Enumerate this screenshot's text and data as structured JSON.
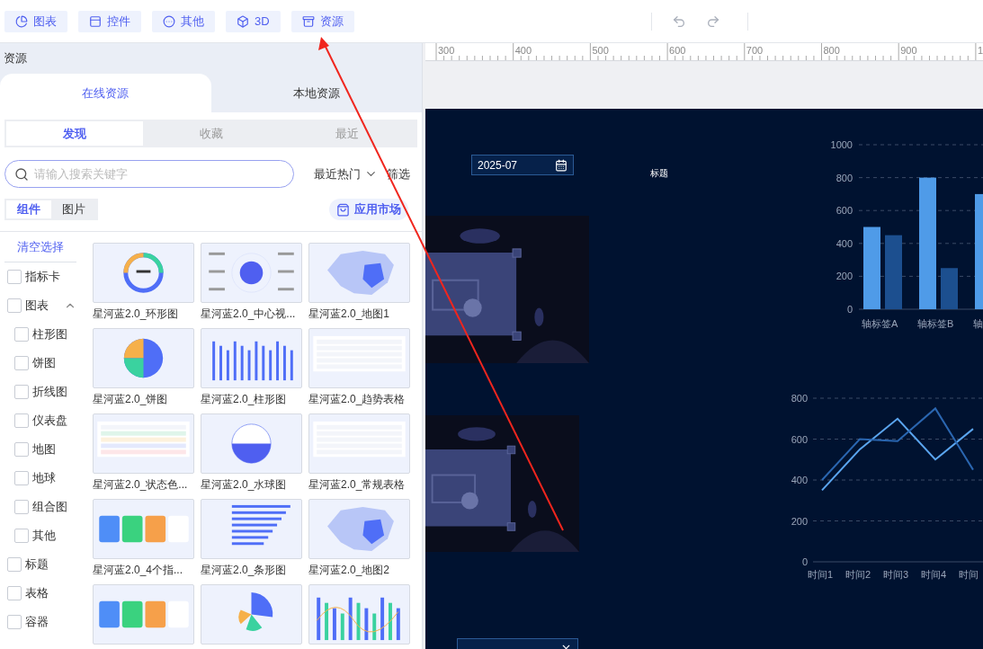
{
  "toolbar": {
    "buttons": [
      {
        "label": "图表",
        "kind": "chart"
      },
      {
        "label": "控件",
        "kind": "control"
      },
      {
        "label": "其他",
        "kind": "other"
      },
      {
        "label": "3D",
        "kind": "cube"
      },
      {
        "label": "资源",
        "kind": "resource"
      }
    ]
  },
  "panel": {
    "title": "资源",
    "source_tabs": [
      {
        "label": "在线资源",
        "selected": true
      },
      {
        "label": "本地资源",
        "selected": false
      }
    ],
    "view_tabs": [
      {
        "label": "发现",
        "selected": true
      },
      {
        "label": "收藏",
        "selected": false
      },
      {
        "label": "最近",
        "selected": false
      }
    ],
    "search": {
      "placeholder": "请输入搜索关键字"
    },
    "sort": "最近热门",
    "filter": "筛选",
    "type_tabs": [
      {
        "label": "组件",
        "selected": true
      },
      {
        "label": "图片",
        "selected": false
      }
    ],
    "market_button": "应用市场",
    "clear_link": "清空选择",
    "categories": [
      {
        "label": "指标卡",
        "checked": false
      },
      {
        "label": "图表",
        "checked": false,
        "expanded": true,
        "children": [
          {
            "label": "柱形图",
            "checked": false
          },
          {
            "label": "饼图",
            "checked": false
          },
          {
            "label": "折线图",
            "checked": false
          },
          {
            "label": "仪表盘",
            "checked": false
          },
          {
            "label": "地图",
            "checked": false
          },
          {
            "label": "地球",
            "checked": false
          },
          {
            "label": "组合图",
            "checked": false
          },
          {
            "label": "其他",
            "checked": false
          }
        ]
      },
      {
        "label": "标题",
        "checked": false
      },
      {
        "label": "表格",
        "checked": false
      },
      {
        "label": "容器",
        "checked": false
      }
    ],
    "cards": [
      {
        "title": "星河蓝2.0_环形图",
        "kind": "donut"
      },
      {
        "title": "星河蓝2.0_中心视...",
        "kind": "radial"
      },
      {
        "title": "星河蓝2.0_地图1",
        "kind": "map"
      },
      {
        "title": "星河蓝2.0_饼图",
        "kind": "pie"
      },
      {
        "title": "星河蓝2.0_柱形图",
        "kind": "bars"
      },
      {
        "title": "星河蓝2.0_趋势表格",
        "kind": "table"
      },
      {
        "title": "星河蓝2.0_状态色...",
        "kind": "status-table"
      },
      {
        "title": "星河蓝2.0_水球图",
        "kind": "gauge"
      },
      {
        "title": "星河蓝2.0_常规表格",
        "kind": "table"
      },
      {
        "title": "星河蓝2.0_4个指...",
        "kind": "kpi"
      },
      {
        "title": "星河蓝2.0_条形图",
        "kind": "hbars"
      },
      {
        "title": "星河蓝2.0_地图2",
        "kind": "map"
      },
      {
        "kind": "kpi"
      },
      {
        "kind": "rose"
      },
      {
        "kind": "combo"
      }
    ]
  },
  "ruler": {
    "labels": [
      "300",
      "400",
      "500",
      "600",
      "700",
      "800",
      "900",
      "1"
    ]
  },
  "canvas": {
    "date_field": {
      "value": "2025-07"
    },
    "title_text": "标题",
    "bar_chart": {
      "chart_data": {
        "type": "bar",
        "categories": [
          "轴标签A",
          "轴标签B",
          "轴"
        ],
        "yticks": [
          0,
          200,
          400,
          600,
          800,
          1000
        ],
        "ylim": [
          0,
          1000
        ],
        "grid": true,
        "series": [
          {
            "color": "#4f9be8",
            "values": [
              500,
              800,
              700
            ]
          },
          {
            "color": "#1c4f8f",
            "values": [
              450,
              250,
              null
            ]
          }
        ]
      }
    },
    "line_chart": {
      "chart_data": {
        "type": "line",
        "categories": [
          "时间1",
          "时间2",
          "时间3",
          "时间4",
          "时间"
        ],
        "yticks": [
          0,
          200,
          400,
          600,
          800
        ],
        "ylim": [
          0,
          800
        ],
        "grid": true,
        "series": [
          {
            "color": "#5aa5ee",
            "values": [
              350,
              550,
              700,
              500,
              650
            ]
          },
          {
            "color": "#2a66b0",
            "values": [
              400,
              600,
              590,
              750,
              450
            ]
          }
        ]
      }
    }
  }
}
